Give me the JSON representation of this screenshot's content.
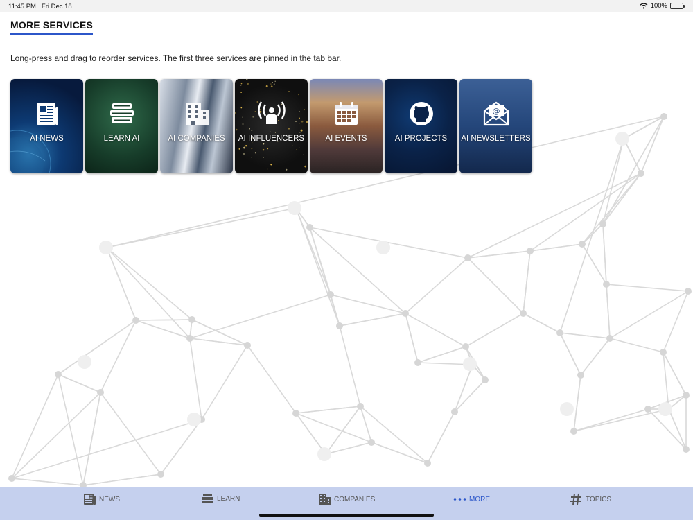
{
  "status_bar": {
    "time": "11:45 PM",
    "date": "Fri Dec 18",
    "battery_percent": "100%",
    "battery_level": 1.0,
    "icons": [
      "wifi-icon",
      "battery-icon"
    ]
  },
  "page": {
    "title": "MORE SERVICES",
    "instructions": "Long-press and drag to reorder services. The first three services are pinned in the tab bar."
  },
  "services": [
    {
      "label": "AI NEWS",
      "icon": "newspaper-icon"
    },
    {
      "label": "LEARN AI",
      "icon": "books-icon"
    },
    {
      "label": "AI COMPANIES",
      "icon": "building-icon"
    },
    {
      "label": "AI INFLUENCERS",
      "icon": "broadcast-icon"
    },
    {
      "label": "AI EVENTS",
      "icon": "calendar-icon"
    },
    {
      "label": "AI PROJECTS",
      "icon": "github-icon"
    },
    {
      "label": "AI NEWSLETTERS",
      "icon": "envelope-icon"
    }
  ],
  "tab_bar": {
    "active_index": 3,
    "accent_color": "#2c56c9",
    "background_color": "#c5d0ee",
    "items": [
      {
        "label": "NEWS",
        "icon": "newspaper-icon"
      },
      {
        "label": "LEARN",
        "icon": "books-icon"
      },
      {
        "label": "COMPANIES",
        "icon": "building-icon"
      },
      {
        "label": "MORE",
        "icon": "more-dots-icon"
      },
      {
        "label": "TOPICS",
        "icon": "hashtag-icon"
      }
    ]
  }
}
